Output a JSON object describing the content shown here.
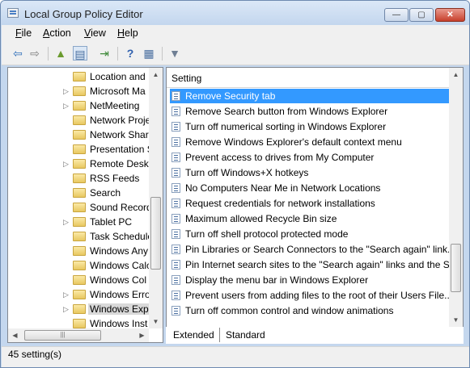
{
  "window": {
    "title": "Local Group Policy Editor",
    "controls": {
      "minimize": "—",
      "maximize": "▢",
      "close": "✕"
    }
  },
  "menu": [
    {
      "pre": "",
      "ul": "F",
      "post": "ile"
    },
    {
      "pre": "",
      "ul": "A",
      "post": "ction"
    },
    {
      "pre": "",
      "ul": "V",
      "post": "iew"
    },
    {
      "pre": "",
      "ul": "H",
      "post": "elp"
    }
  ],
  "toolbar": {
    "buttons": [
      {
        "name": "back-icon",
        "glyph": "⇦",
        "color": "#2f6fba"
      },
      {
        "name": "forward-icon",
        "glyph": "⇨",
        "color": "#7f7f7f"
      },
      {
        "name": "up-folder-icon",
        "glyph": "▲",
        "color": "#6a9a2e"
      },
      {
        "name": "show-hide-tree-icon",
        "glyph": "▤",
        "color": "#4a6fa0"
      },
      {
        "name": "export-list-icon",
        "glyph": "⇥",
        "color": "#3f8a3a"
      },
      {
        "name": "help-icon",
        "glyph": "?",
        "color": "#2e5fae"
      },
      {
        "name": "properties-icon",
        "glyph": "▦",
        "color": "#4a6fa0"
      },
      {
        "name": "filter-icon",
        "glyph": "▼",
        "color": "#6f7f94"
      }
    ]
  },
  "tree": {
    "items": [
      {
        "label": "Location and",
        "arrow": ""
      },
      {
        "label": "Microsoft Ma",
        "arrow": "▷"
      },
      {
        "label": "NetMeeting",
        "arrow": "▷"
      },
      {
        "label": "Network Proje",
        "arrow": ""
      },
      {
        "label": "Network Shar",
        "arrow": ""
      },
      {
        "label": "Presentation S",
        "arrow": ""
      },
      {
        "label": "Remote Deskt",
        "arrow": "▷"
      },
      {
        "label": "RSS Feeds",
        "arrow": ""
      },
      {
        "label": "Search",
        "arrow": ""
      },
      {
        "label": "Sound Record",
        "arrow": ""
      },
      {
        "label": "Tablet PC",
        "arrow": "▷"
      },
      {
        "label": "Task Schedule",
        "arrow": ""
      },
      {
        "label": "Windows Any",
        "arrow": ""
      },
      {
        "label": "Windows Calc",
        "arrow": ""
      },
      {
        "label": "Windows Col",
        "arrow": ""
      },
      {
        "label": "Windows Erro",
        "arrow": "▷"
      },
      {
        "label": "Windows Exp",
        "arrow": "▷"
      },
      {
        "label": "Windows Inst",
        "arrow": ""
      }
    ],
    "selected_index": 16
  },
  "list": {
    "column_header": "Setting",
    "selected_index": 0,
    "rows": [
      "Remove Security tab",
      "Remove Search button from Windows Explorer",
      "Turn off numerical sorting in Windows Explorer",
      "Remove Windows Explorer's default context menu",
      "Prevent access to drives from My Computer",
      "Turn off Windows+X hotkeys",
      "No Computers Near Me in Network Locations",
      "Request credentials for network installations",
      "Maximum allowed Recycle Bin size",
      "Turn off shell protocol protected mode",
      "Pin Libraries or Search Connectors to the \"Search again\" link...",
      "Pin Internet search sites to the \"Search again\" links and the S...",
      "Display the menu bar in Windows Explorer",
      "Prevent users from adding files to the root of their Users File...",
      "Turn off common control and window animations"
    ]
  },
  "tabs": [
    "Extended",
    "Standard"
  ],
  "status": {
    "text": "45 setting(s)"
  },
  "colors": {
    "selection": "#3399ff",
    "frame": "#c4d7ee"
  }
}
